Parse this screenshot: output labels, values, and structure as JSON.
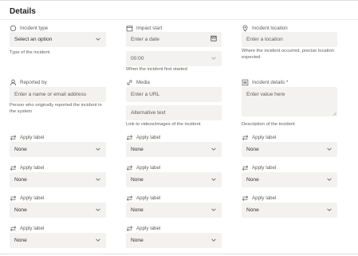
{
  "header": {
    "title": "Details"
  },
  "incident_type": {
    "label": "Incident type",
    "value": "Select an option",
    "help": "Type of the incident"
  },
  "impact_start": {
    "label": "Impact start",
    "placeholder": "Enter a date",
    "time_value": "00:00",
    "help": "When the incident first started"
  },
  "incident_location": {
    "label": "Incident location",
    "placeholder": "Enter a location",
    "help_line1": "Where the incident occurred, precise location",
    "help_line2": "expected"
  },
  "reported_by": {
    "label": "Reported by",
    "placeholder": "Enter a name or email address",
    "help_line1": "Person who originally reported the incident in",
    "help_line2": "the system"
  },
  "media": {
    "label": "Media",
    "url_placeholder": "Enter a URL",
    "alt_placeholder": "Alternative text",
    "help": "Link to videos/images of the incident"
  },
  "incident_details": {
    "label": "Incident details *",
    "placeholder": "Enter value here",
    "help": "Description of the incident"
  },
  "apply_labels": {
    "label": "Apply label",
    "value": "None"
  },
  "icons": {
    "incident_type": "circle-icon",
    "impact_start": "calendar-icon",
    "incident_location": "location-pin-icon",
    "reported_by": "person-icon",
    "media": "link-icon",
    "incident_details": "text-lines-icon",
    "apply_label": "swap-arrows-icon",
    "dropdown": "chevron-down-icon"
  }
}
